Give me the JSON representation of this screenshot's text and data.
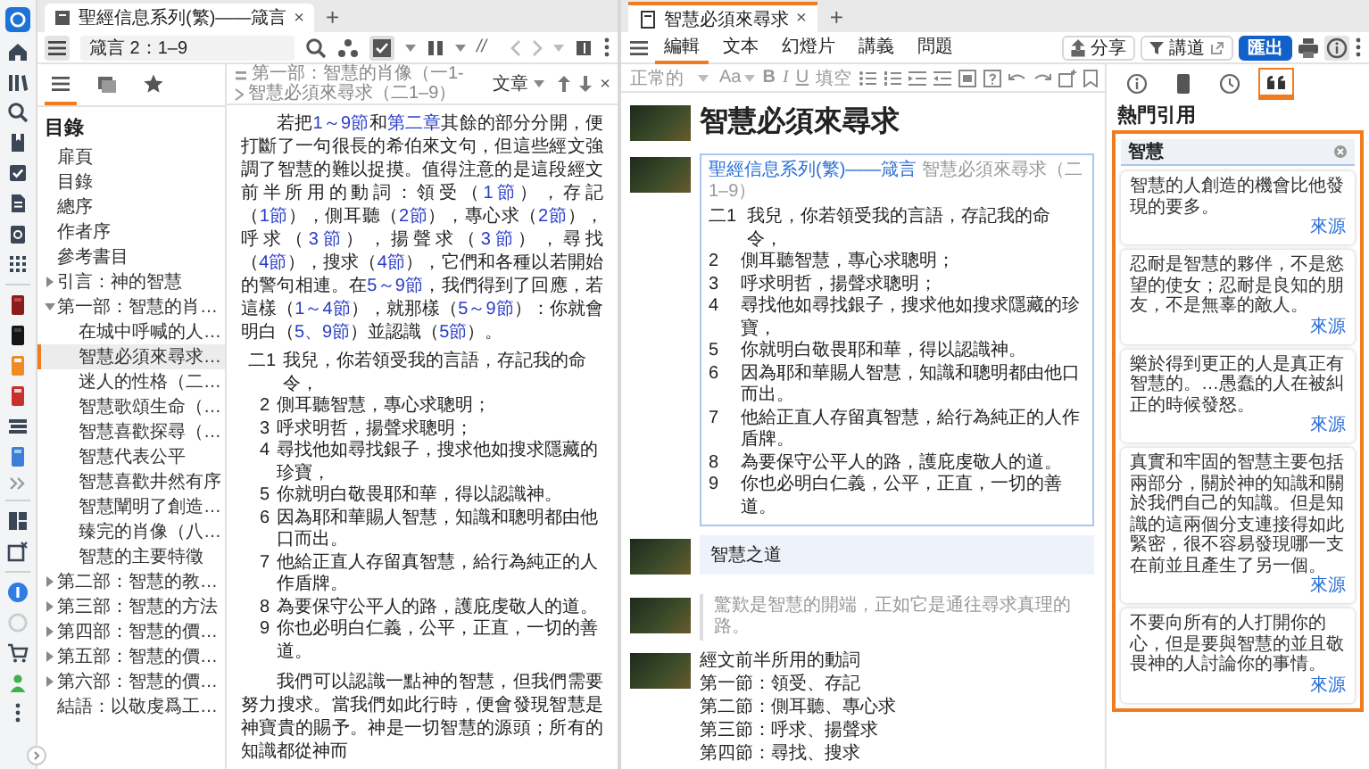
{
  "left_pane": {
    "tab": {
      "title": "聖經信息系列(繁)——箴言",
      "close": "×"
    },
    "new_tab": "+",
    "toolbar": {
      "reference": "箴言 2：1–9",
      "slashes": "//"
    },
    "toc_tabs": [
      {
        "kind": "contents",
        "selected": true
      },
      {
        "kind": "images",
        "selected": false
      },
      {
        "kind": "favorites",
        "selected": false
      }
    ],
    "toc": {
      "heading": "目錄",
      "items": [
        {
          "label": "扉頁",
          "selected": false
        },
        {
          "label": "目錄",
          "selected": false
        },
        {
          "label": "總序",
          "selected": false
        },
        {
          "label": "作者序",
          "selected": false
        },
        {
          "label": "參考書目",
          "selected": false
        },
        {
          "label": "引言：神的智慧",
          "selected": false,
          "expanded": false
        },
        {
          "label": "第一部：智慧的肖…",
          "selected": false,
          "expanded": true,
          "children": [
            {
              "label": "在城中呼喊的人…",
              "selected": false
            },
            {
              "label": "智慧必須來尋求…",
              "selected": true
            },
            {
              "label": "迷人的性格（二…",
              "selected": false
            },
            {
              "label": "智慧歌頌生命（…",
              "selected": false
            },
            {
              "label": "智慧喜歡探尋（…",
              "selected": false
            },
            {
              "label": "智慧代表公平",
              "selected": false
            },
            {
              "label": "智慧喜歡井然有序",
              "selected": false
            },
            {
              "label": "智慧闡明了創造…",
              "selected": false
            },
            {
              "label": "臻完的肖像（八…",
              "selected": false
            },
            {
              "label": "智慧的主要特徵",
              "selected": false
            }
          ]
        },
        {
          "label": "第二部：智慧的教…",
          "selected": false,
          "expanded": false
        },
        {
          "label": "第三部：智慧的方法",
          "selected": false,
          "expanded": false
        },
        {
          "label": "第四部：智慧的價…",
          "selected": false,
          "expanded": false
        },
        {
          "label": "第五部：智慧的價…",
          "selected": false,
          "expanded": false
        },
        {
          "label": "第六部：智慧的價…",
          "selected": false,
          "expanded": false
        },
        {
          "label": "結語：以敬虔爲工…",
          "selected": false
        }
      ]
    },
    "breadcrumb": [
      "第一部：智慧的肖像（一1-",
      "智慧必須來尋求（二1–9）"
    ],
    "view_select": "文章",
    "close": "×",
    "paragraph": [
      {
        "kind": "text",
        "text": "若把"
      },
      {
        "kind": "link",
        "text": "1～9節"
      },
      {
        "kind": "text",
        "text": "和"
      },
      {
        "kind": "link",
        "text": "第二章"
      },
      {
        "kind": "text",
        "text": "其餘的部分分開，便打斷了一句很長的希伯來文句，但這些經文強調了智慧的難以捉摸。值得注意的是這段經文前半所用的動詞：領受（"
      },
      {
        "kind": "link",
        "text": "1節"
      },
      {
        "kind": "text",
        "text": "），存記（"
      },
      {
        "kind": "link",
        "text": "1節"
      },
      {
        "kind": "text",
        "text": "），側耳聽（"
      },
      {
        "kind": "link",
        "text": "2節"
      },
      {
        "kind": "text",
        "text": "），專心求（"
      },
      {
        "kind": "link",
        "text": "2節"
      },
      {
        "kind": "text",
        "text": "），呼求（"
      },
      {
        "kind": "link",
        "text": "3節"
      },
      {
        "kind": "text",
        "text": "），揚聲求（"
      },
      {
        "kind": "link",
        "text": "3節"
      },
      {
        "kind": "text",
        "text": "），尋找（"
      },
      {
        "kind": "link",
        "text": "4節"
      },
      {
        "kind": "text",
        "text": "），搜求（"
      },
      {
        "kind": "link",
        "text": "4節"
      },
      {
        "kind": "text",
        "text": "），它們和各種以若開始的警句相連。在"
      },
      {
        "kind": "link",
        "text": "5～9節"
      },
      {
        "kind": "text",
        "text": "，我們得到了回應，若這樣（"
      },
      {
        "kind": "link",
        "text": "1～4節"
      },
      {
        "kind": "text",
        "text": "），就那樣（"
      },
      {
        "kind": "link",
        "text": "5～9節"
      },
      {
        "kind": "text",
        "text": "）：你就會明白（"
      },
      {
        "kind": "link",
        "text": "5、9節"
      },
      {
        "kind": "text",
        "text": "）並認識（"
      },
      {
        "kind": "link",
        "text": "5節"
      },
      {
        "kind": "text",
        "text": "）。"
      }
    ],
    "verses": [
      {
        "number": "二1",
        "text": "我兒，你若領受我的言語，存記我的命令，"
      },
      {
        "number": "2",
        "text": "側耳聽智慧，專心求聰明；"
      },
      {
        "number": "3",
        "text": "呼求明哲，揚聲求聰明；"
      },
      {
        "number": "4",
        "text": "尋找他如尋找銀子，搜求他如搜求隱藏的珍寶，"
      },
      {
        "number": "5",
        "text": "你就明白敬畏耶和華，得以認識神。"
      },
      {
        "number": "6",
        "text": "因為耶和華賜人智慧，知識和聰明都由他口而出。"
      },
      {
        "number": "7",
        "text": "他給正直人存留真智慧，給行為純正的人作盾牌。"
      },
      {
        "number": "8",
        "text": "為要保守公平人的路，護庇虔敬人的道。"
      },
      {
        "number": "9",
        "text": "你也必明白仁義，公平，正直，一切的善道。"
      }
    ],
    "closing_paragraph": "我們可以認識一點神的智慧，但我們需要努力搜求。當我們如此行時，便會發現智慧是神寶貴的賜予。神是一切智慧的源頭；所有的知識都從神而"
  },
  "middle_pane": {
    "tab": {
      "title": "智慧必須來尋求",
      "close": "×"
    },
    "new_tab": "+",
    "menu_tabs": [
      {
        "label": "編輯",
        "selected": true
      },
      {
        "label": "文本",
        "selected": false
      },
      {
        "label": "幻燈片",
        "selected": false
      },
      {
        "label": "講義",
        "selected": false
      },
      {
        "label": "問題",
        "selected": false
      }
    ],
    "actions": {
      "share": "分享",
      "preach": "講道",
      "export": "匯出"
    },
    "format_bar": {
      "style": "正常的",
      "font_size": "Aa",
      "bold": "B",
      "italic": "I",
      "underline": "U",
      "cloze": "填空"
    },
    "slides": [
      {
        "kind": "title",
        "text": "智慧必須來尋求"
      },
      {
        "kind": "scripture",
        "source": "聖經信息系列(繁)——箴言",
        "reference": "智慧必須來尋求（二1–9）",
        "verses": [
          {
            "number": "二1",
            "text": "我兒，你若領受我的言語，存記我的命令，"
          },
          {
            "number": "2",
            "text": "側耳聽智慧，專心求聰明；"
          },
          {
            "number": "3",
            "text": "呼求明哲，揚聲求聰明；"
          },
          {
            "number": "4",
            "text": "尋找他如尋找銀子，搜求他如搜求隱藏的珍寶，"
          },
          {
            "number": "5",
            "text": "你就明白敬畏耶和華，得以認識神。"
          },
          {
            "number": "6",
            "text": "因為耶和華賜人智慧，知識和聰明都由他口而出。"
          },
          {
            "number": "7",
            "text": "他給正直人存留真智慧，給行為純正的人作盾牌。"
          },
          {
            "number": "8",
            "text": "為要保守公平人的路，護庇虔敬人的道。"
          },
          {
            "number": "9",
            "text": "你也必明白仁義，公平，正直，一切的善道。"
          }
        ]
      },
      {
        "kind": "heading",
        "text": "智慧之道"
      },
      {
        "kind": "quote",
        "text": "驚歎是智慧的開端，正如它是通往尋求真理的路。"
      },
      {
        "kind": "list",
        "lines": [
          "經文前半所用的動詞",
          "第一節：領受、存記",
          "第二節：側耳聽、專心求",
          "第三節：呼求、揚聲求",
          "第四節：尋找、搜求"
        ]
      }
    ]
  },
  "side_panel": {
    "tabs": [
      {
        "kind": "info",
        "selected": false
      },
      {
        "kind": "book",
        "selected": false
      },
      {
        "kind": "history",
        "selected": false
      },
      {
        "kind": "quote",
        "selected": true
      }
    ],
    "heading": "熱門引用",
    "search": {
      "value": "智慧"
    },
    "quotes": [
      {
        "text": "智慧的人創造的機會比他發現的要多。",
        "source": "來源"
      },
      {
        "text": "忍耐是智慧的夥伴，不是慾望的使女；忍耐是良知的朋友，不是無辜的敵人。",
        "source": "來源"
      },
      {
        "text": "樂於得到更正的人是真正有智慧的。…愚蠢的人在被糾正的時候發怒。",
        "source": "來源"
      },
      {
        "text": "真實和牢固的智慧主要包括兩部分，關於神的知識和關於我們自己的知識。但是知識的這兩個分支連接得如此緊密，很不容易發現哪一支在前並且產生了另一個。",
        "source": "來源"
      },
      {
        "text": "不要向所有的人打開你的心，但是要與智慧的並且敬畏神的人討論你的事情。",
        "source": "來源"
      }
    ]
  }
}
